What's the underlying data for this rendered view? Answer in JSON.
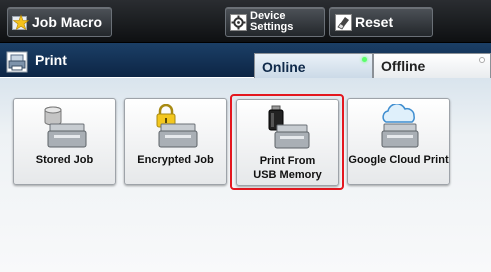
{
  "top_bar": {
    "job_macro_label": "Job Macro",
    "device_settings_label": "Device\nSettings",
    "reset_label": "Reset"
  },
  "print_bar": {
    "title": "Print",
    "tabs": [
      {
        "label": "Online",
        "active": true
      },
      {
        "label": "Offline",
        "active": false
      }
    ]
  },
  "apps": [
    {
      "label": "Stored Job",
      "icon": "stored-job-icon"
    },
    {
      "label": "Encrypted Job",
      "icon": "encrypted-job-icon"
    },
    {
      "label": "Print From USB Memory",
      "icon": "usb-memory-icon",
      "selected": true
    },
    {
      "label": "Google Cloud Print",
      "icon": "cloud-print-icon"
    }
  ],
  "colors": {
    "header_dark": "#0e1012",
    "print_bar_blue": "#0d2545",
    "selection_red": "#e4171f",
    "online_led_green": "#5aff6a"
  }
}
